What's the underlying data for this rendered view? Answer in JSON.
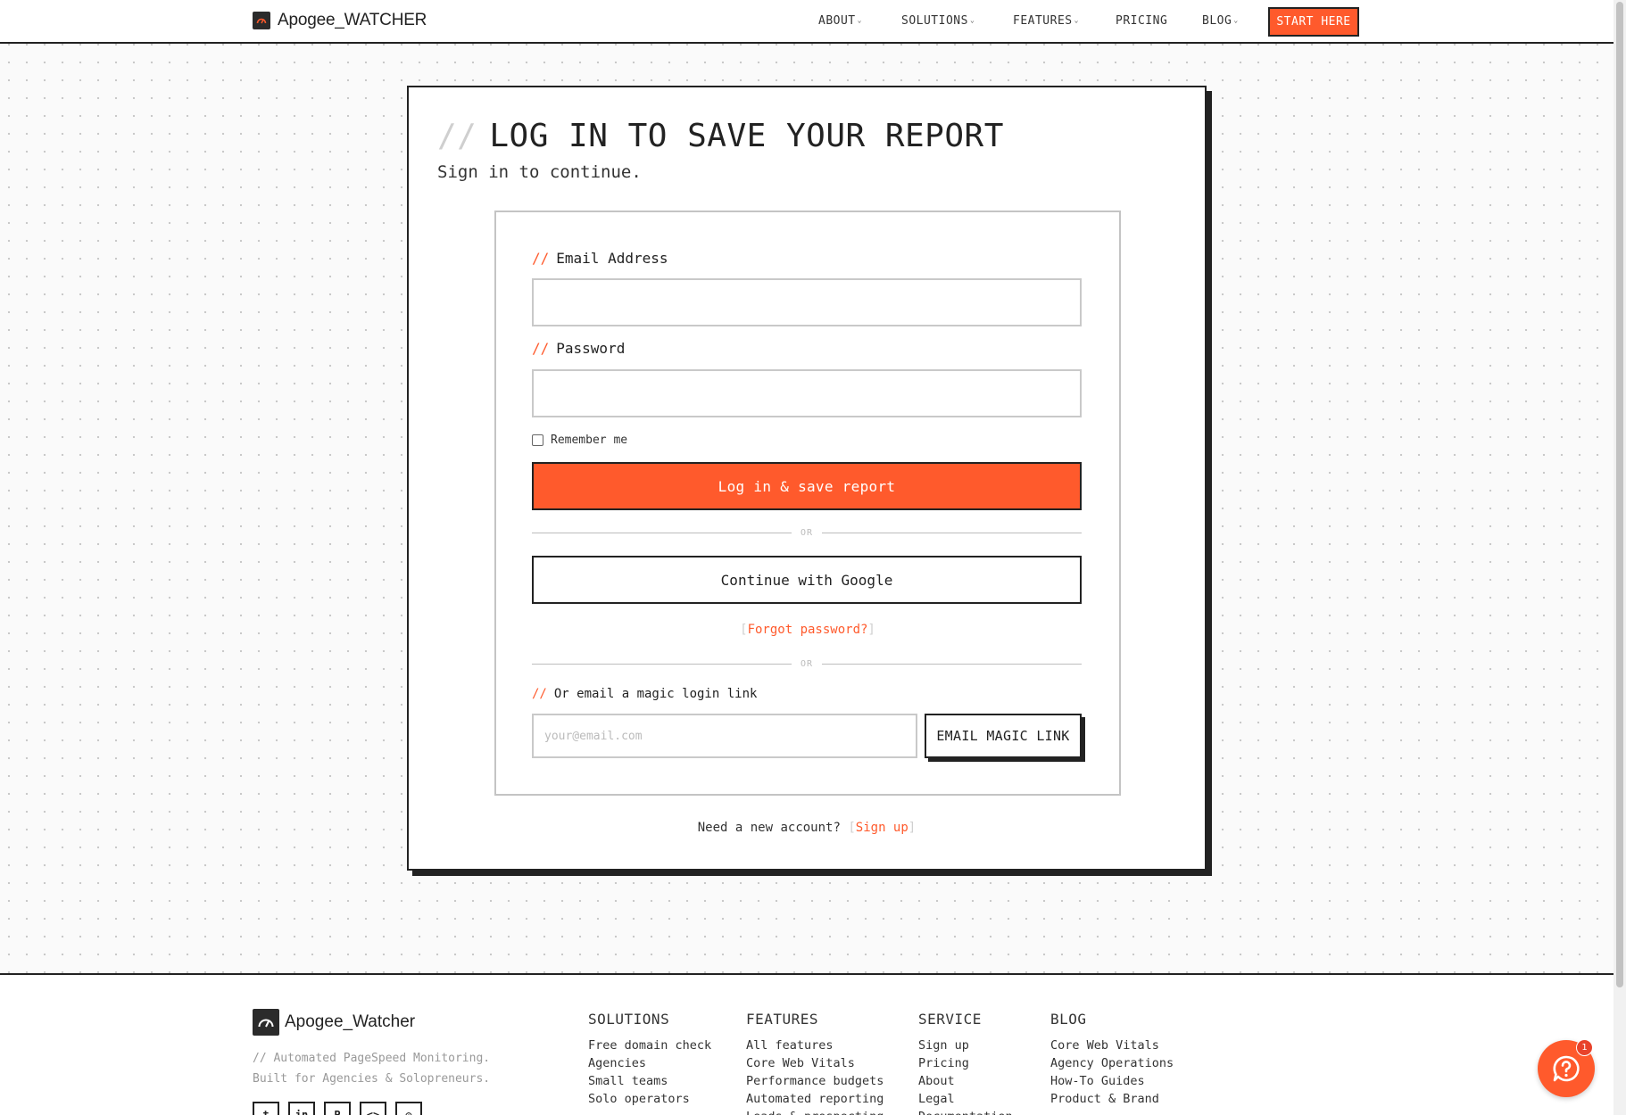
{
  "header": {
    "brand": "Apogee_WATCHER",
    "nav": [
      {
        "label": "ABOUT",
        "has_caret": true
      },
      {
        "label": "SOLUTIONS",
        "has_caret": true
      },
      {
        "label": "FEATURES",
        "has_caret": true
      },
      {
        "label": "PRICING",
        "has_caret": false
      },
      {
        "label": "BLOG",
        "has_caret": true
      }
    ],
    "cta": "START HERE",
    "caret_icon": "chevron-down-icon"
  },
  "card": {
    "slashes": "//",
    "title": "LOG IN TO SAVE YOUR REPORT",
    "subtitle": "Sign in to continue."
  },
  "form": {
    "accent_prefix": "//",
    "email_label": "Email Address",
    "email_value": "",
    "password_label": "Password",
    "password_value": "",
    "remember_label": "Remember me",
    "remember_checked": false,
    "submit_label": "Log in & save report",
    "or_label": "OR",
    "google_label": "Continue with Google",
    "forgot": {
      "open": "[",
      "label": "Forgot password?",
      "close": "]"
    },
    "magic_label": "Or email a magic login link",
    "magic_placeholder": "your@email.com",
    "magic_button": "EMAIL MAGIC LINK"
  },
  "signup": {
    "prompt": "Need a new account?",
    "open": "[",
    "label": "Sign up",
    "close": "]"
  },
  "footer": {
    "brand": "Apogee_Watcher",
    "tagline_1": "// Automated PageSpeed Monitoring.",
    "tagline_2": "Built for Agencies & Solopreneurs.",
    "social": [
      {
        "name": "twitter-icon",
        "glyph": "t"
      },
      {
        "name": "linkedin-icon",
        "glyph": "in"
      },
      {
        "name": "producthunt-icon",
        "glyph": "P"
      },
      {
        "name": "code-icon",
        "glyph": "<>"
      },
      {
        "name": "instagram-icon",
        "glyph": "◎"
      }
    ],
    "columns": [
      {
        "title": "SOLUTIONS",
        "items": [
          "Free domain check",
          "Agencies",
          "Small teams",
          "Solo operators"
        ]
      },
      {
        "title": "FEATURES",
        "items": [
          "All features",
          "Core Web Vitals",
          "Performance budgets",
          "Automated reporting",
          "Leads & prospecting"
        ]
      },
      {
        "title": "SERVICE",
        "items": [
          "Sign up",
          "Pricing",
          "About",
          "Legal",
          "Documentation"
        ]
      },
      {
        "title": "BLOG",
        "items": [
          "Core Web Vitals",
          "Agency Operations",
          "How-To Guides",
          "Product & Brand"
        ]
      }
    ]
  },
  "chat": {
    "badge": "1",
    "icon": "help-chat-icon"
  },
  "colors": {
    "accent": "#ff5a2c",
    "ink": "#222222",
    "muted": "#999999"
  }
}
